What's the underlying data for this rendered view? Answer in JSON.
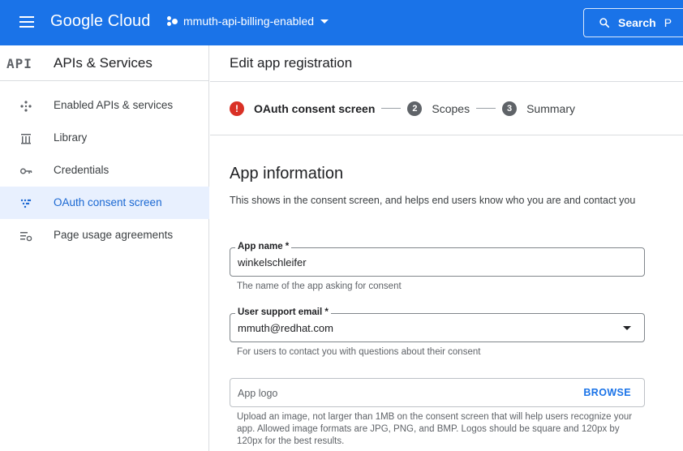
{
  "topbar": {
    "brand": "Google Cloud",
    "project": "mmuth-api-billing-enabled",
    "search_label": "Search",
    "search_overflow": "P"
  },
  "sidebar": {
    "badge": "API",
    "title": "APIs & Services",
    "items": [
      {
        "label": "Enabled APIs & services",
        "icon": "enabled-apis-icon"
      },
      {
        "label": "Library",
        "icon": "library-icon"
      },
      {
        "label": "Credentials",
        "icon": "key-icon"
      },
      {
        "label": "OAuth consent screen",
        "icon": "oauth-icon",
        "active": true
      },
      {
        "label": "Page usage agreements",
        "icon": "settings-list-icon"
      }
    ]
  },
  "main": {
    "title": "Edit app registration",
    "steps": [
      {
        "num": "!",
        "label": "OAuth consent screen",
        "state": "error"
      },
      {
        "num": "2",
        "label": "Scopes"
      },
      {
        "num": "3",
        "label": "Summary"
      }
    ],
    "section_title": "App information",
    "section_desc": "This shows in the consent screen, and helps end users know who you are and contact you",
    "fields": {
      "app_name": {
        "label": "App name *",
        "value": "winkelschleifer",
        "hint": "The name of the app asking for consent"
      },
      "support_email": {
        "label": "User support email *",
        "value": "mmuth@redhat.com",
        "hint": "For users to contact you with questions about their consent"
      },
      "app_logo": {
        "placeholder": "App logo",
        "action": "BROWSE",
        "hint": "Upload an image, not larger than 1MB on the consent screen that will help users recognize your app. Allowed image formats are JPG, PNG, and BMP. Logos should be square and 120px by 120px for the best results."
      }
    }
  },
  "colors": {
    "topbar": "#1a73e8",
    "active_nav_bg": "#e8f0fe",
    "active_nav_text": "#1967d2",
    "error": "#d93025",
    "link": "#1a73e8"
  }
}
